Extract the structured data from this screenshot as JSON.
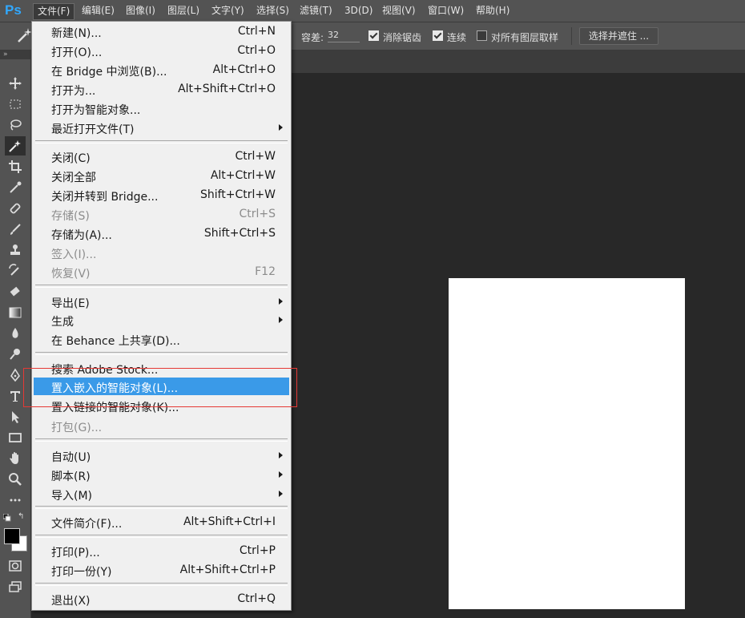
{
  "menubar": {
    "logo": "Ps",
    "items": [
      {
        "label": "文件(F)",
        "active": true
      },
      {
        "label": "编辑(E)"
      },
      {
        "label": "图像(I)"
      },
      {
        "label": "图层(L)"
      },
      {
        "label": "文字(Y)"
      },
      {
        "label": "选择(S)"
      },
      {
        "label": "滤镜(T)"
      },
      {
        "label": "3D(D)"
      },
      {
        "label": "视图(V)"
      },
      {
        "label": "窗口(W)"
      },
      {
        "label": "帮助(H)"
      }
    ]
  },
  "options": {
    "tolerance_label": "容差:",
    "tolerance_value": "32",
    "antialias_label": "消除锯齿",
    "antialias_checked": true,
    "contiguous_label": "连续",
    "contiguous_checked": true,
    "all_layers_label": "对所有图层取样",
    "all_layers_checked": false,
    "select_mask_button": "选择并遮住 ..."
  },
  "file_menu": {
    "items": [
      {
        "label": "新建(N)...",
        "shortcut": "Ctrl+N"
      },
      {
        "label": "打开(O)...",
        "shortcut": "Ctrl+O"
      },
      {
        "label": "在 Bridge 中浏览(B)...",
        "shortcut": "Alt+Ctrl+O"
      },
      {
        "label": "打开为...",
        "shortcut": "Alt+Shift+Ctrl+O"
      },
      {
        "label": "打开为智能对象...",
        "shortcut": ""
      },
      {
        "label": "最近打开文件(T)",
        "shortcut": "",
        "submenu": true
      },
      {
        "label": "关闭(C)",
        "shortcut": "Ctrl+W"
      },
      {
        "label": "关闭全部",
        "shortcut": "Alt+Ctrl+W"
      },
      {
        "label": "关闭并转到 Bridge...",
        "shortcut": "Shift+Ctrl+W"
      },
      {
        "label": "存储(S)",
        "shortcut": "Ctrl+S",
        "disabled": true
      },
      {
        "label": "存储为(A)...",
        "shortcut": "Shift+Ctrl+S"
      },
      {
        "label": "签入(I)...",
        "shortcut": "",
        "disabled": true
      },
      {
        "label": "恢复(V)",
        "shortcut": "F12",
        "disabled": true
      },
      {
        "label": "导出(E)",
        "shortcut": "",
        "submenu": true
      },
      {
        "label": "生成",
        "shortcut": "",
        "submenu": true
      },
      {
        "label": "在 Behance 上共享(D)...",
        "shortcut": ""
      },
      {
        "label": "搜索 Adobe Stock...",
        "shortcut": ""
      },
      {
        "label": "置入嵌入的智能对象(L)...",
        "shortcut": "",
        "highlighted": true
      },
      {
        "label": "置入链接的智能对象(K)...",
        "shortcut": ""
      },
      {
        "label": "打包(G)...",
        "shortcut": "",
        "disabled": true
      },
      {
        "label": "自动(U)",
        "shortcut": "",
        "submenu": true
      },
      {
        "label": "脚本(R)",
        "shortcut": "",
        "submenu": true
      },
      {
        "label": "导入(M)",
        "shortcut": "",
        "submenu": true
      },
      {
        "label": "文件简介(F)...",
        "shortcut": "Alt+Shift+Ctrl+I"
      },
      {
        "label": "打印(P)...",
        "shortcut": "Ctrl+P"
      },
      {
        "label": "打印一份(Y)",
        "shortcut": "Alt+Shift+Ctrl+P"
      },
      {
        "label": "退出(X)",
        "shortcut": "Ctrl+Q"
      }
    ]
  },
  "tools": [
    "move-icon",
    "marquee-icon",
    "lasso-icon",
    "magic-wand-icon",
    "crop-icon",
    "eyedropper-icon",
    "healing-brush-icon",
    "brush-icon",
    "clone-stamp-icon",
    "history-brush-icon",
    "eraser-icon",
    "gradient-icon",
    "blur-icon",
    "dodge-icon",
    "pen-icon",
    "type-icon",
    "path-select-icon",
    "rectangle-icon",
    "hand-icon",
    "zoom-icon",
    "more-tools-icon"
  ],
  "colors": {
    "highlight": "#3a9ae8",
    "annotation": "#e53935",
    "canvas": "#ffffff"
  }
}
